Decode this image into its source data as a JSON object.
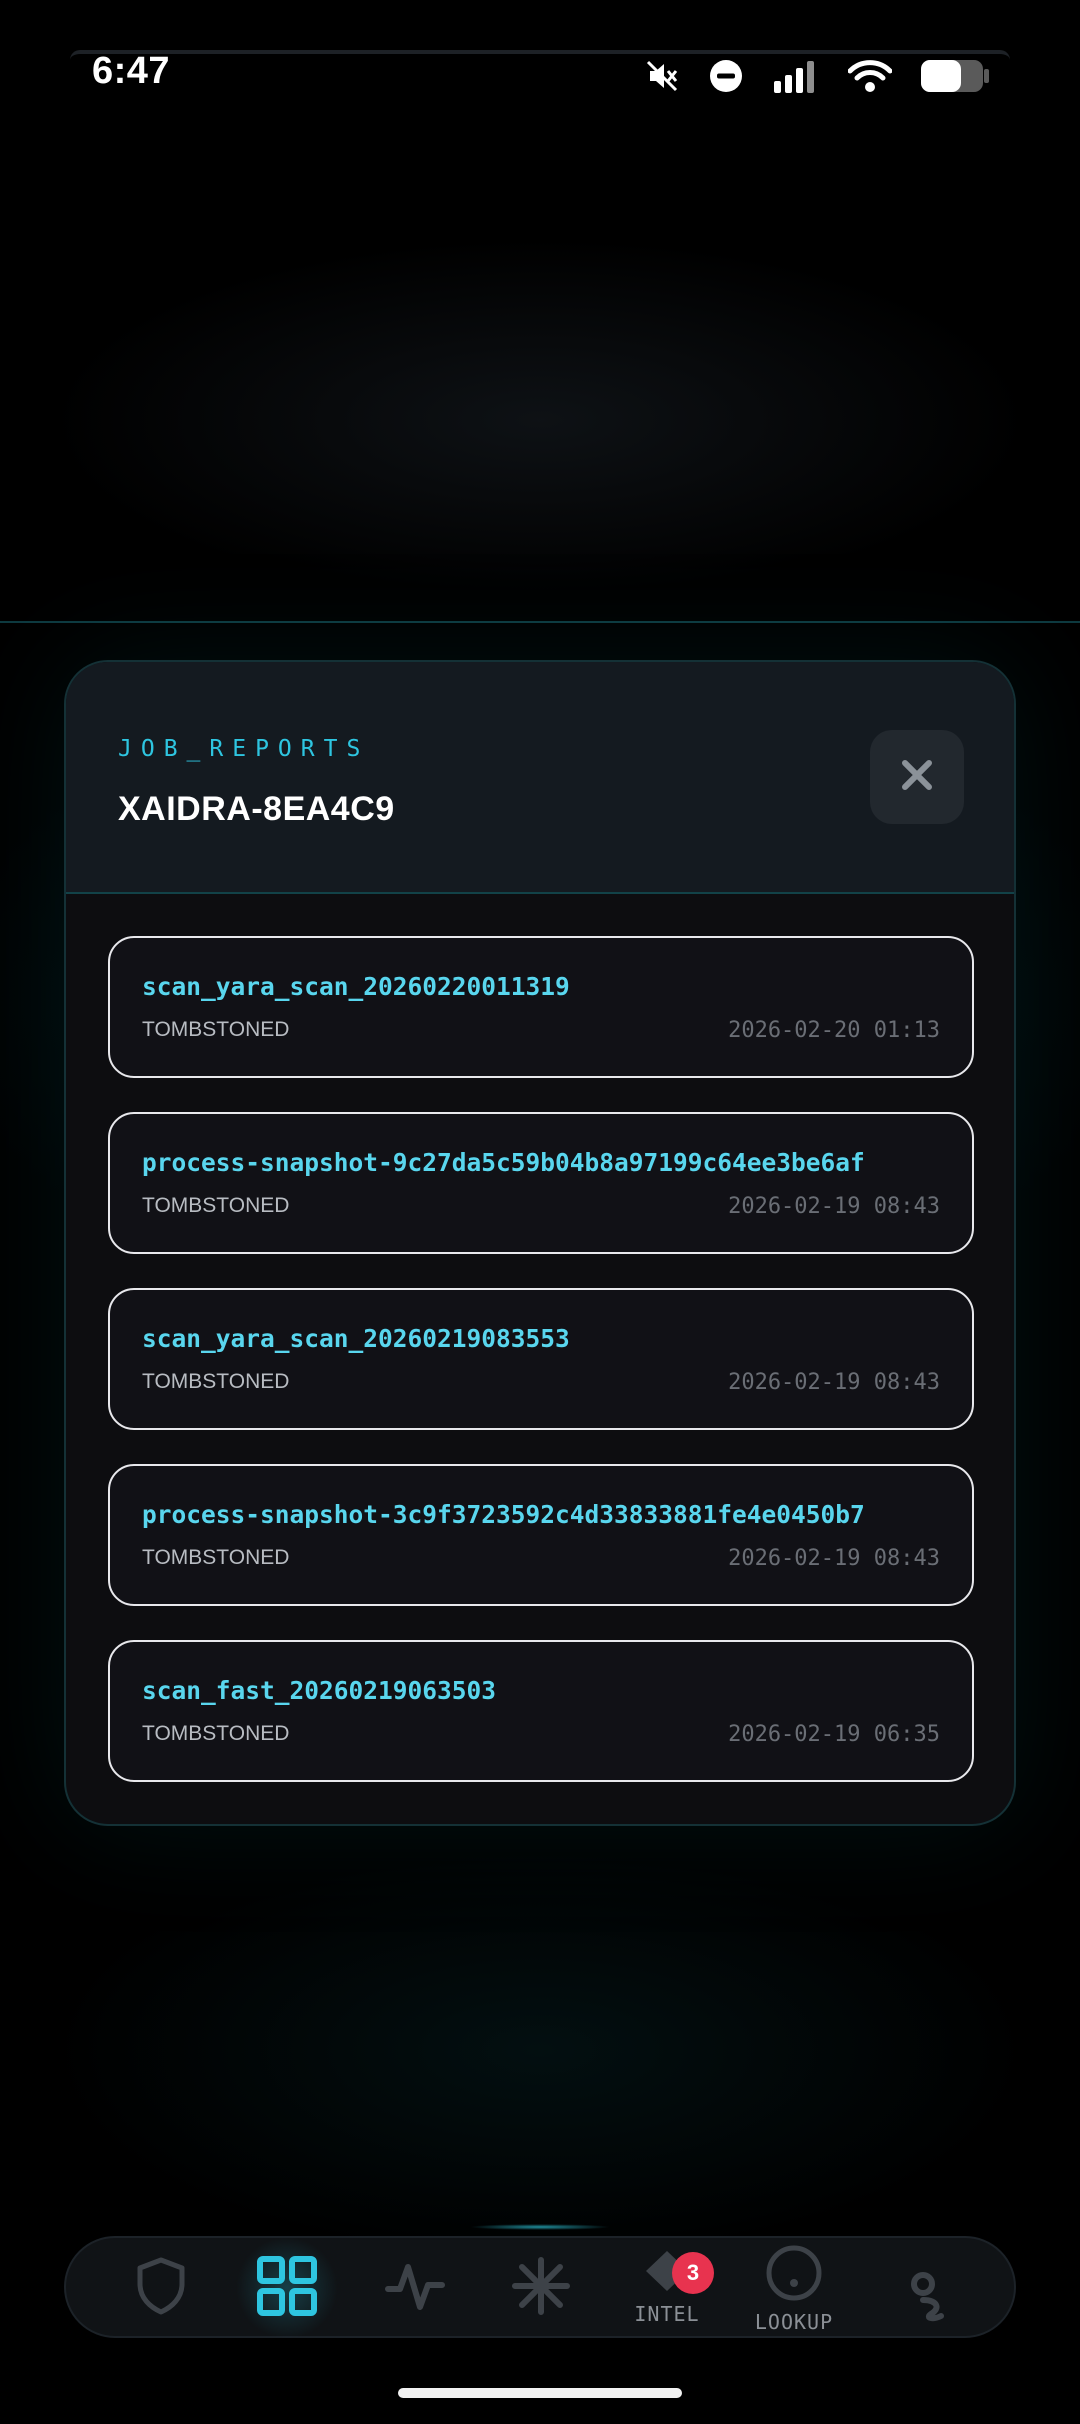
{
  "status_bar": {
    "time": "6:47",
    "icons": [
      "mute-icon",
      "do-not-disturb-icon",
      "signal-icon",
      "wifi-icon",
      "battery-icon"
    ],
    "battery_level": 0.6
  },
  "sheet": {
    "kicker": "JOB_REPORTS",
    "title": "XAIDRA-8EA4C9",
    "close_icon": "close-icon",
    "reports": [
      {
        "name": "scan_yara_scan_20260220011319",
        "status": "TOMBSTONED",
        "time": "2026-02-20 01:13"
      },
      {
        "name": "process-snapshot-9c27da5c59b04b8a97199c64ee3be6af",
        "status": "TOMBSTONED",
        "time": "2026-02-19 08:43"
      },
      {
        "name": "scan_yara_scan_20260219083553",
        "status": "TOMBSTONED",
        "time": "2026-02-19 08:43"
      },
      {
        "name": "process-snapshot-3c9f3723592c4d33833881fe4e0450b7",
        "status": "TOMBSTONED",
        "time": "2026-02-19 08:43"
      },
      {
        "name": "scan_fast_20260219063503",
        "status": "TOMBSTONED",
        "time": "2026-02-19 06:35"
      }
    ]
  },
  "nav": {
    "items": [
      {
        "icon": "shield-icon",
        "label": ""
      },
      {
        "icon": "grid-icon",
        "label": "",
        "active": true
      },
      {
        "icon": "pulse-icon",
        "label": ""
      },
      {
        "icon": "asterisk-icon",
        "label": ""
      },
      {
        "icon": "intel-icon",
        "label": "INTEL",
        "badge": "3"
      },
      {
        "icon": "lookup-icon",
        "label": "LOOKUP"
      },
      {
        "icon": "profile-icon",
        "label": ""
      }
    ]
  },
  "colors": {
    "accent": "#2ec5e0",
    "report_name": "#59d6ee",
    "badge": "#e8334f",
    "background": "#000000"
  }
}
